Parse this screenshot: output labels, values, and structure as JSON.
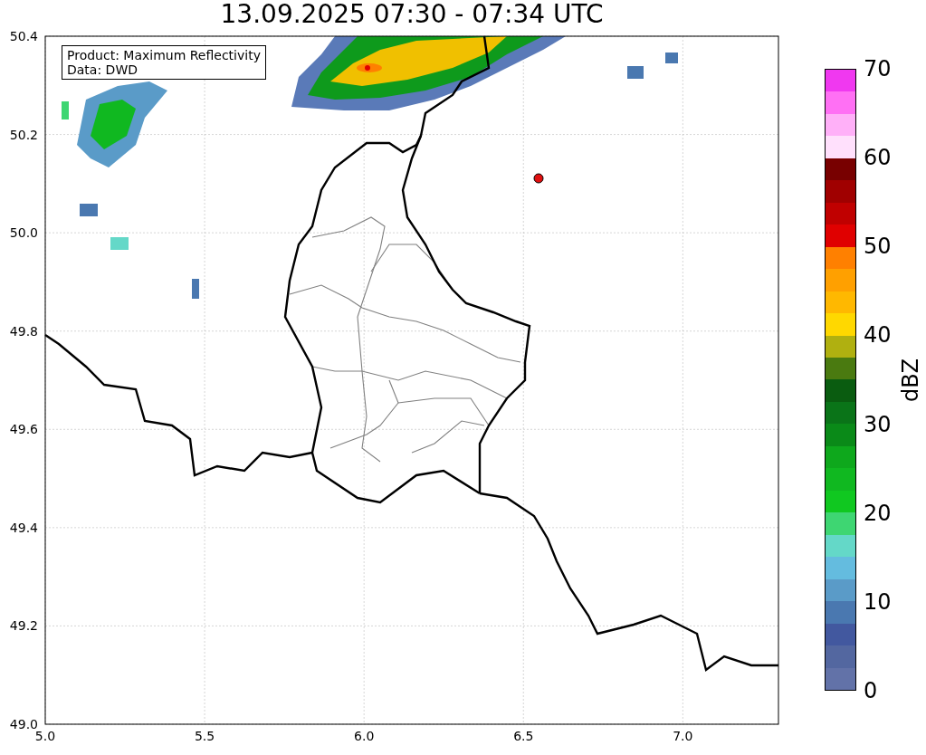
{
  "title": "13.09.2025 07:30 - 07:34 UTC",
  "info_box": {
    "lines": [
      "Product: Maximum Reflectivity",
      "Data: DWD"
    ]
  },
  "axes": {
    "x_ticks": [
      "5.0",
      "5.5",
      "6.0",
      "6.5",
      "7.0"
    ],
    "y_ticks": [
      "50.4",
      "50.2",
      "50.0",
      "49.8",
      "49.6",
      "49.4",
      "49.2",
      "49.0"
    ]
  },
  "colorbar": {
    "label": "dBZ",
    "ticks": [
      "70",
      "60",
      "50",
      "40",
      "30",
      "20",
      "10",
      "0"
    ],
    "segments": [
      {
        "color": "#6272a8"
      },
      {
        "color": "#5367a0"
      },
      {
        "color": "#42589f"
      },
      {
        "color": "#4a78b0"
      },
      {
        "color": "#5a9bc8"
      },
      {
        "color": "#64bcdf"
      },
      {
        "color": "#64d8c8"
      },
      {
        "color": "#3ed672"
      },
      {
        "color": "#10c820"
      },
      {
        "color": "#10b820"
      },
      {
        "color": "#0ea81c"
      },
      {
        "color": "#0a8a18"
      },
      {
        "color": "#0a7418"
      },
      {
        "color": "#0a5c10"
      },
      {
        "color": "#4a7a10"
      },
      {
        "color": "#b0b010"
      },
      {
        "color": "#ffd800"
      },
      {
        "color": "#ffb800"
      },
      {
        "color": "#ffa000"
      },
      {
        "color": "#ff8000"
      },
      {
        "color": "#e00000"
      },
      {
        "color": "#c00000"
      },
      {
        "color": "#a00000"
      },
      {
        "color": "#780000"
      },
      {
        "color": "#ffe0fc"
      },
      {
        "color": "#ffb0f8"
      },
      {
        "color": "#ff70f4"
      },
      {
        "color": "#f038f0"
      }
    ]
  }
}
